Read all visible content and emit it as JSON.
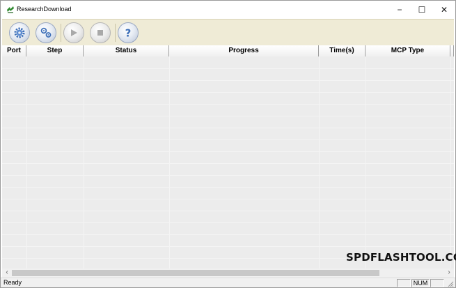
{
  "window": {
    "title": "ResearchDownload",
    "controls": {
      "minimize": "−",
      "maximize": "☐",
      "close": "✕"
    }
  },
  "toolbar": {
    "buttons": [
      {
        "name": "load-packet",
        "icon": "gear-icon",
        "enabled": true
      },
      {
        "name": "settings",
        "icon": "gears-icon",
        "enabled": true
      },
      {
        "name": "start-downloading",
        "icon": "play-icon",
        "enabled": false
      },
      {
        "name": "stop-downloading",
        "icon": "stop-icon",
        "enabled": false
      },
      {
        "name": "about",
        "icon": "help-icon",
        "enabled": true
      }
    ]
  },
  "table": {
    "columns": [
      "Port",
      "Step",
      "Status",
      "Progress",
      "Time(s)",
      "MCP Type"
    ],
    "rows": []
  },
  "watermark": "SPDFLASHTOOL.COM",
  "scrollbar": {
    "left_arrow": "‹",
    "right_arrow": "›"
  },
  "statusbar": {
    "text": "Ready",
    "panels": [
      "",
      "NUM",
      ""
    ]
  },
  "colors": {
    "toolbar_bg": "#efebd6",
    "table_bg": "#ececec",
    "accent_blue": "#3d6fb8"
  }
}
